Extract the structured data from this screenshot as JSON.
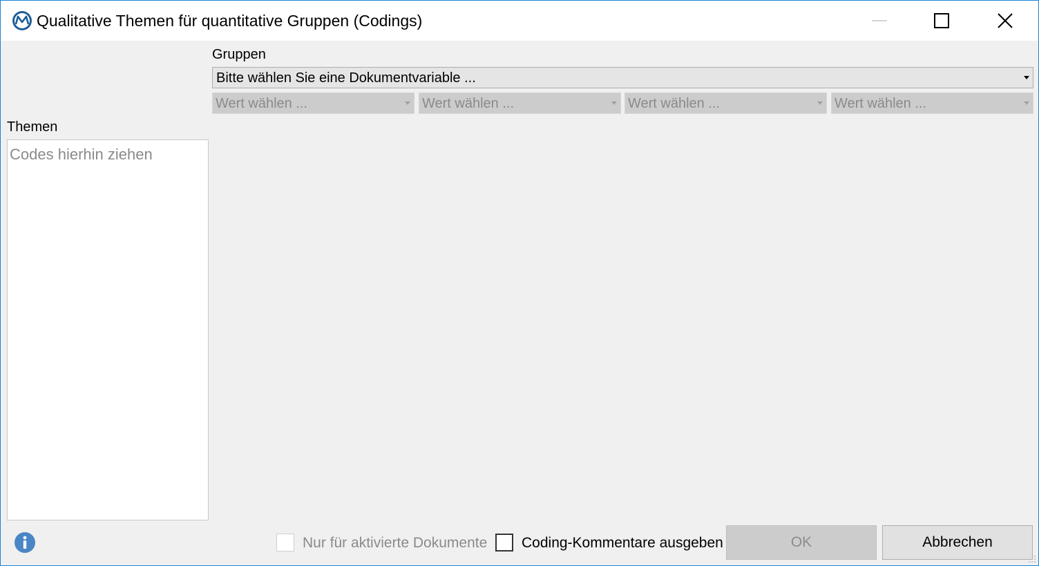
{
  "window": {
    "title": "Qualitative Themen für quantitative Gruppen (Codings)",
    "border_color": "#1783d8"
  },
  "titlebar": {
    "app_icon": "maxqda-logo-icon",
    "minimize_icon": "minimize-icon",
    "maximize_icon": "maximize-icon",
    "close_icon": "close-icon"
  },
  "groups": {
    "label": "Gruppen",
    "variable_select": {
      "value": "Bitte wählen Sie eine Dokumentvariable ..."
    },
    "value_selects": [
      {
        "value": "Wert wählen ..."
      },
      {
        "value": "Wert wählen ..."
      },
      {
        "value": "Wert wählen ..."
      },
      {
        "value": "Wert wählen ..."
      }
    ]
  },
  "themes": {
    "label": "Themen",
    "placeholder": "Codes hierhin ziehen"
  },
  "footer": {
    "info_icon": "info-icon",
    "only_activated_label": "Nur für aktivierte Dokumente",
    "only_activated_checked": false,
    "coding_comments_label": "Coding-Kommentare ausgeben",
    "coding_comments_checked": false,
    "ok_label": "OK",
    "cancel_label": "Abbrechen"
  },
  "colors": {
    "accent": "#1783d8",
    "icon_blue": "#2e6da4",
    "info_blue": "#4a86c5"
  }
}
